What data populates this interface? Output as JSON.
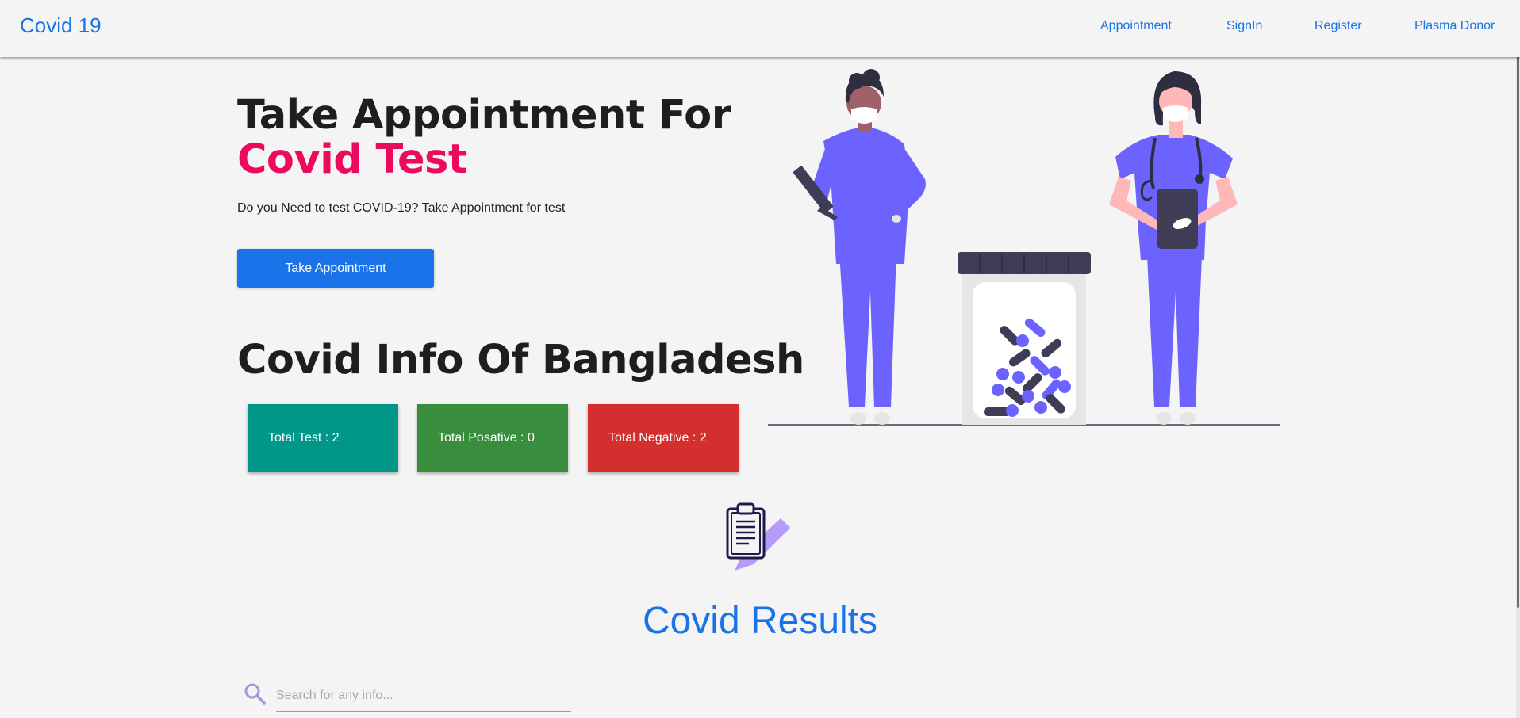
{
  "navbar": {
    "brand": "Covid 19",
    "links": [
      "Appointment",
      "SignIn",
      "Register",
      "Plasma Donor"
    ]
  },
  "hero": {
    "title_line1": "Take Appointment For",
    "title_line2": "Covid Test",
    "subtitle": "Do you Need to test COVID-19? Take Appointment for test",
    "cta_label": "Take Appointment"
  },
  "covid_info": {
    "title": "Covid Info Of Bangladesh",
    "cards": [
      {
        "label": "Total Test : 2",
        "color": "#009688"
      },
      {
        "label": "Total Posative : 0",
        "color": "#388e3c"
      },
      {
        "label": "Total Negative : 2",
        "color": "#d32f2f"
      }
    ]
  },
  "results": {
    "title": "Covid Results",
    "search_placeholder": "Search for any info..."
  },
  "colors": {
    "primary": "#1a73e8",
    "accent": "#ec0a5c",
    "illustration": "#6c63ff",
    "dark": "#3f3d56"
  },
  "icons": [
    "search-icon",
    "clipboard-icon",
    "pencil-icon"
  ]
}
